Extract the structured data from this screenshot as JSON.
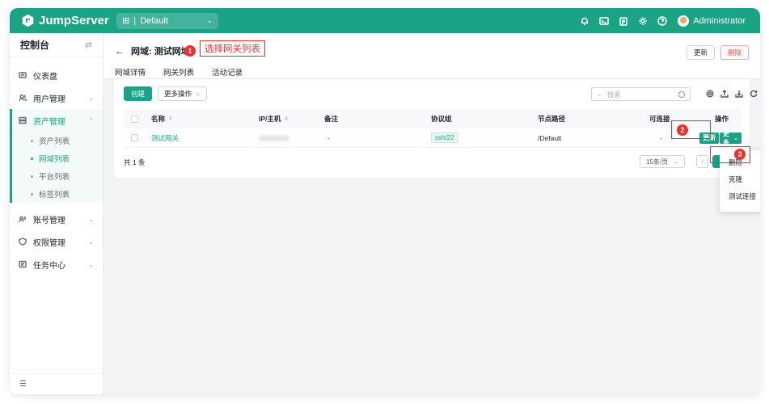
{
  "app": {
    "name": "JumpServer"
  },
  "org": {
    "icon": "org-icon",
    "label": "Default"
  },
  "topbar": {
    "icons": [
      "bell-icon",
      "terminal-icon",
      "clipboard-icon",
      "gear-icon",
      "help-icon"
    ],
    "user": "Administrator"
  },
  "sidebar": {
    "title": "控制台",
    "items": [
      {
        "label": "仪表盘",
        "icon": "dashboard-icon"
      },
      {
        "label": "用户管理",
        "icon": "users-icon"
      },
      {
        "label": "资产管理",
        "icon": "assets-icon"
      },
      {
        "label": "账号管理",
        "icon": "accounts-icon"
      },
      {
        "label": "权限管理",
        "icon": "shield-icon"
      },
      {
        "label": "任务中心",
        "icon": "tasks-icon"
      }
    ],
    "sub_items": [
      "资产列表",
      "网域列表",
      "平台列表",
      "标签列表"
    ],
    "footer_icon": "collapse-icon"
  },
  "page": {
    "title": "网域: 测试网域",
    "tabs": [
      "网域详情",
      "网关列表",
      "活动记录"
    ],
    "update_btn": "更新",
    "delete_btn": "删除"
  },
  "annotations": {
    "n1": "1",
    "n1_text": "选择网关列表",
    "n2": "2",
    "n3": "3"
  },
  "toolbar": {
    "create": "创建",
    "more_actions": "更多操作",
    "search_placeholder": "搜索"
  },
  "table": {
    "headers": [
      "名称",
      "IP/主机",
      "备注",
      "协议组",
      "节点路径",
      "可连接",
      "操作"
    ],
    "rows": [
      {
        "name": "测试网关",
        "comment": "-",
        "protocol": "ssh/22",
        "node": "/Default",
        "connectivity": "-",
        "update": "更新",
        "more": "更多"
      }
    ],
    "total": "共 1 条",
    "page_size": "15条/页"
  },
  "dropdown": {
    "items": [
      "删除",
      "克隆",
      "测试连接"
    ]
  },
  "colors": {
    "brand": "#1ba385",
    "annotation": "#e8332d"
  }
}
